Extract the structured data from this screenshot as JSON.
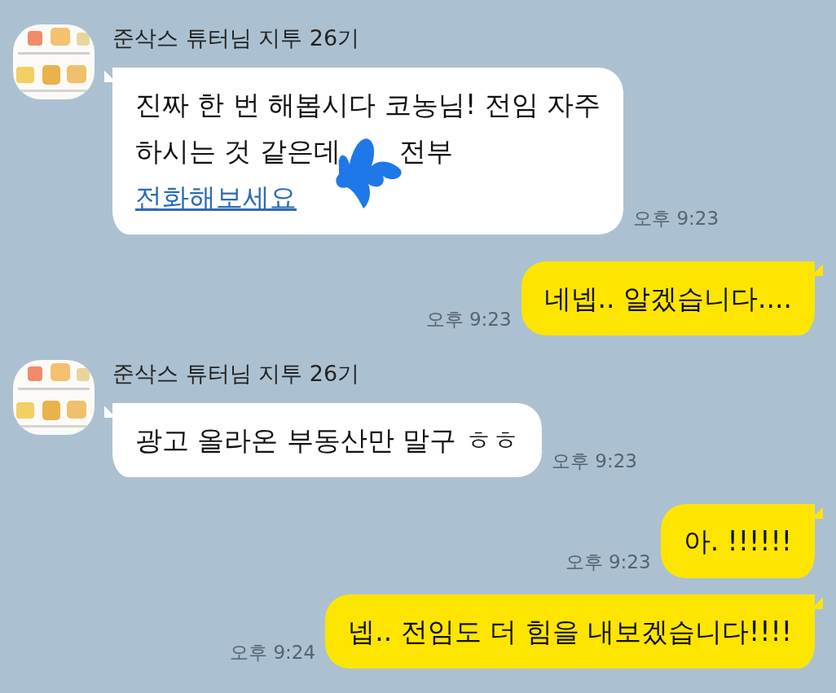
{
  "messages": [
    {
      "kind": "incoming",
      "sender": "준삭스 튜터님 지투 26기",
      "lines": [
        [
          {
            "kind": "text",
            "text": "진짜 한 번 해봅시다 코농님! 전임 자주"
          }
        ],
        [
          {
            "kind": "text",
            "text": "하시는 것 같은데"
          },
          {
            "kind": "redacted"
          },
          {
            "kind": "text",
            "text": "전부"
          }
        ],
        [
          {
            "kind": "link",
            "text": "전화해보세요"
          }
        ]
      ],
      "time": "오후 9:23"
    },
    {
      "kind": "outgoing",
      "lines": [
        [
          {
            "kind": "text",
            "text": "네넵.. 알겠습니다...."
          }
        ]
      ],
      "time": "오후 9:23"
    },
    {
      "kind": "incoming",
      "sender": "준삭스 튜터님 지투 26기",
      "lines": [
        [
          {
            "kind": "text",
            "text": "광고 올라온 부동산만 말구 ㅎㅎ"
          }
        ]
      ],
      "time": "오후 9:23"
    },
    {
      "kind": "outgoing",
      "lines": [
        [
          {
            "kind": "text",
            "text": "아. !!!!!!"
          }
        ]
      ],
      "time": "오후 9:23"
    },
    {
      "kind": "outgoing",
      "lines": [
        [
          {
            "kind": "text",
            "text": "넵.. 전임도 더 힘을 내보겠습니다!!!!"
          }
        ]
      ],
      "time": "오후 9:24"
    }
  ]
}
